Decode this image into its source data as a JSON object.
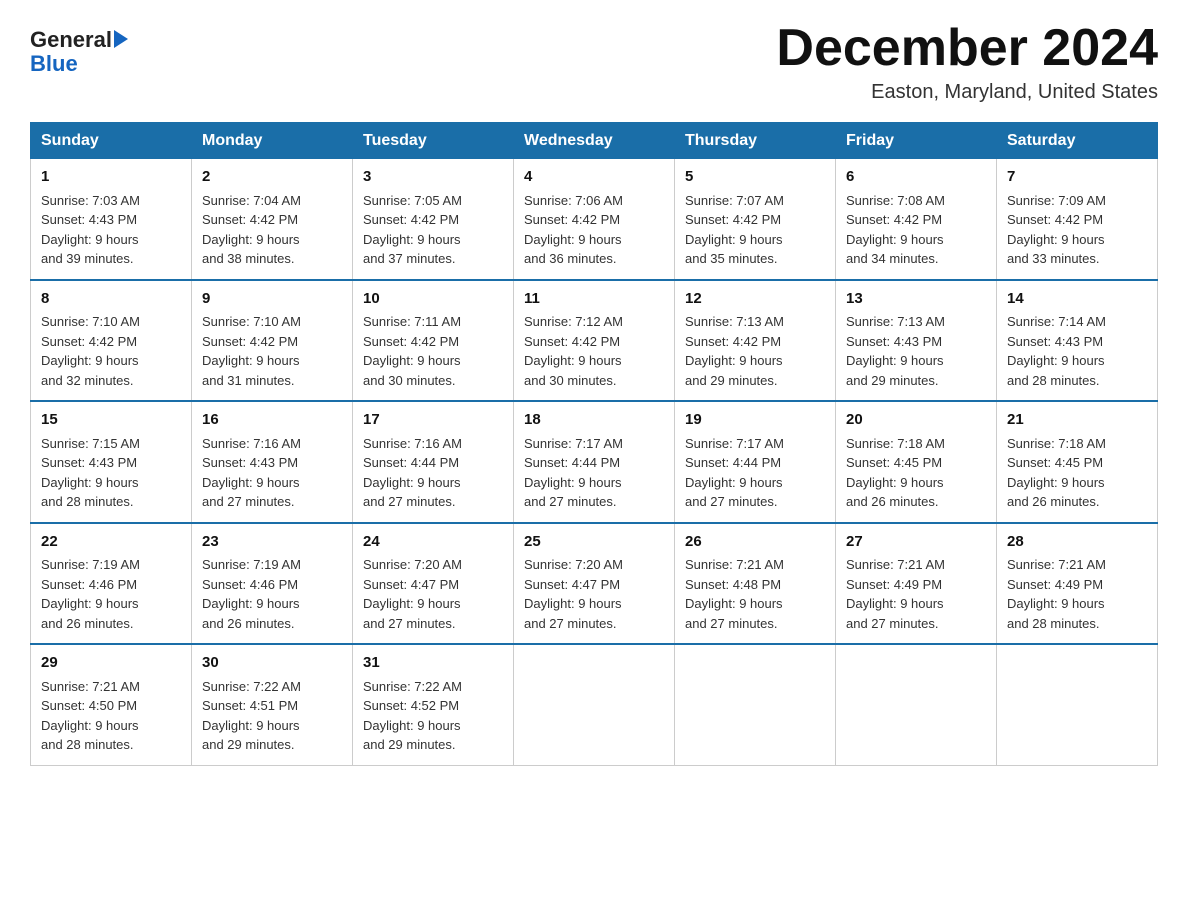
{
  "header": {
    "logo_line1": "General",
    "logo_line2": "Blue",
    "month_title": "December 2024",
    "location": "Easton, Maryland, United States"
  },
  "weekdays": [
    "Sunday",
    "Monday",
    "Tuesday",
    "Wednesday",
    "Thursday",
    "Friday",
    "Saturday"
  ],
  "weeks": [
    [
      {
        "day": "1",
        "sunrise": "7:03 AM",
        "sunset": "4:43 PM",
        "daylight": "9 hours and 39 minutes."
      },
      {
        "day": "2",
        "sunrise": "7:04 AM",
        "sunset": "4:42 PM",
        "daylight": "9 hours and 38 minutes."
      },
      {
        "day": "3",
        "sunrise": "7:05 AM",
        "sunset": "4:42 PM",
        "daylight": "9 hours and 37 minutes."
      },
      {
        "day": "4",
        "sunrise": "7:06 AM",
        "sunset": "4:42 PM",
        "daylight": "9 hours and 36 minutes."
      },
      {
        "day": "5",
        "sunrise": "7:07 AM",
        "sunset": "4:42 PM",
        "daylight": "9 hours and 35 minutes."
      },
      {
        "day": "6",
        "sunrise": "7:08 AM",
        "sunset": "4:42 PM",
        "daylight": "9 hours and 34 minutes."
      },
      {
        "day": "7",
        "sunrise": "7:09 AM",
        "sunset": "4:42 PM",
        "daylight": "9 hours and 33 minutes."
      }
    ],
    [
      {
        "day": "8",
        "sunrise": "7:10 AM",
        "sunset": "4:42 PM",
        "daylight": "9 hours and 32 minutes."
      },
      {
        "day": "9",
        "sunrise": "7:10 AM",
        "sunset": "4:42 PM",
        "daylight": "9 hours and 31 minutes."
      },
      {
        "day": "10",
        "sunrise": "7:11 AM",
        "sunset": "4:42 PM",
        "daylight": "9 hours and 30 minutes."
      },
      {
        "day": "11",
        "sunrise": "7:12 AM",
        "sunset": "4:42 PM",
        "daylight": "9 hours and 30 minutes."
      },
      {
        "day": "12",
        "sunrise": "7:13 AM",
        "sunset": "4:42 PM",
        "daylight": "9 hours and 29 minutes."
      },
      {
        "day": "13",
        "sunrise": "7:13 AM",
        "sunset": "4:43 PM",
        "daylight": "9 hours and 29 minutes."
      },
      {
        "day": "14",
        "sunrise": "7:14 AM",
        "sunset": "4:43 PM",
        "daylight": "9 hours and 28 minutes."
      }
    ],
    [
      {
        "day": "15",
        "sunrise": "7:15 AM",
        "sunset": "4:43 PM",
        "daylight": "9 hours and 28 minutes."
      },
      {
        "day": "16",
        "sunrise": "7:16 AM",
        "sunset": "4:43 PM",
        "daylight": "9 hours and 27 minutes."
      },
      {
        "day": "17",
        "sunrise": "7:16 AM",
        "sunset": "4:44 PM",
        "daylight": "9 hours and 27 minutes."
      },
      {
        "day": "18",
        "sunrise": "7:17 AM",
        "sunset": "4:44 PM",
        "daylight": "9 hours and 27 minutes."
      },
      {
        "day": "19",
        "sunrise": "7:17 AM",
        "sunset": "4:44 PM",
        "daylight": "9 hours and 27 minutes."
      },
      {
        "day": "20",
        "sunrise": "7:18 AM",
        "sunset": "4:45 PM",
        "daylight": "9 hours and 26 minutes."
      },
      {
        "day": "21",
        "sunrise": "7:18 AM",
        "sunset": "4:45 PM",
        "daylight": "9 hours and 26 minutes."
      }
    ],
    [
      {
        "day": "22",
        "sunrise": "7:19 AM",
        "sunset": "4:46 PM",
        "daylight": "9 hours and 26 minutes."
      },
      {
        "day": "23",
        "sunrise": "7:19 AM",
        "sunset": "4:46 PM",
        "daylight": "9 hours and 26 minutes."
      },
      {
        "day": "24",
        "sunrise": "7:20 AM",
        "sunset": "4:47 PM",
        "daylight": "9 hours and 27 minutes."
      },
      {
        "day": "25",
        "sunrise": "7:20 AM",
        "sunset": "4:47 PM",
        "daylight": "9 hours and 27 minutes."
      },
      {
        "day": "26",
        "sunrise": "7:21 AM",
        "sunset": "4:48 PM",
        "daylight": "9 hours and 27 minutes."
      },
      {
        "day": "27",
        "sunrise": "7:21 AM",
        "sunset": "4:49 PM",
        "daylight": "9 hours and 27 minutes."
      },
      {
        "day": "28",
        "sunrise": "7:21 AM",
        "sunset": "4:49 PM",
        "daylight": "9 hours and 28 minutes."
      }
    ],
    [
      {
        "day": "29",
        "sunrise": "7:21 AM",
        "sunset": "4:50 PM",
        "daylight": "9 hours and 28 minutes."
      },
      {
        "day": "30",
        "sunrise": "7:22 AM",
        "sunset": "4:51 PM",
        "daylight": "9 hours and 29 minutes."
      },
      {
        "day": "31",
        "sunrise": "7:22 AM",
        "sunset": "4:52 PM",
        "daylight": "9 hours and 29 minutes."
      },
      null,
      null,
      null,
      null
    ]
  ],
  "labels": {
    "sunrise": "Sunrise:",
    "sunset": "Sunset:",
    "daylight": "Daylight:"
  }
}
